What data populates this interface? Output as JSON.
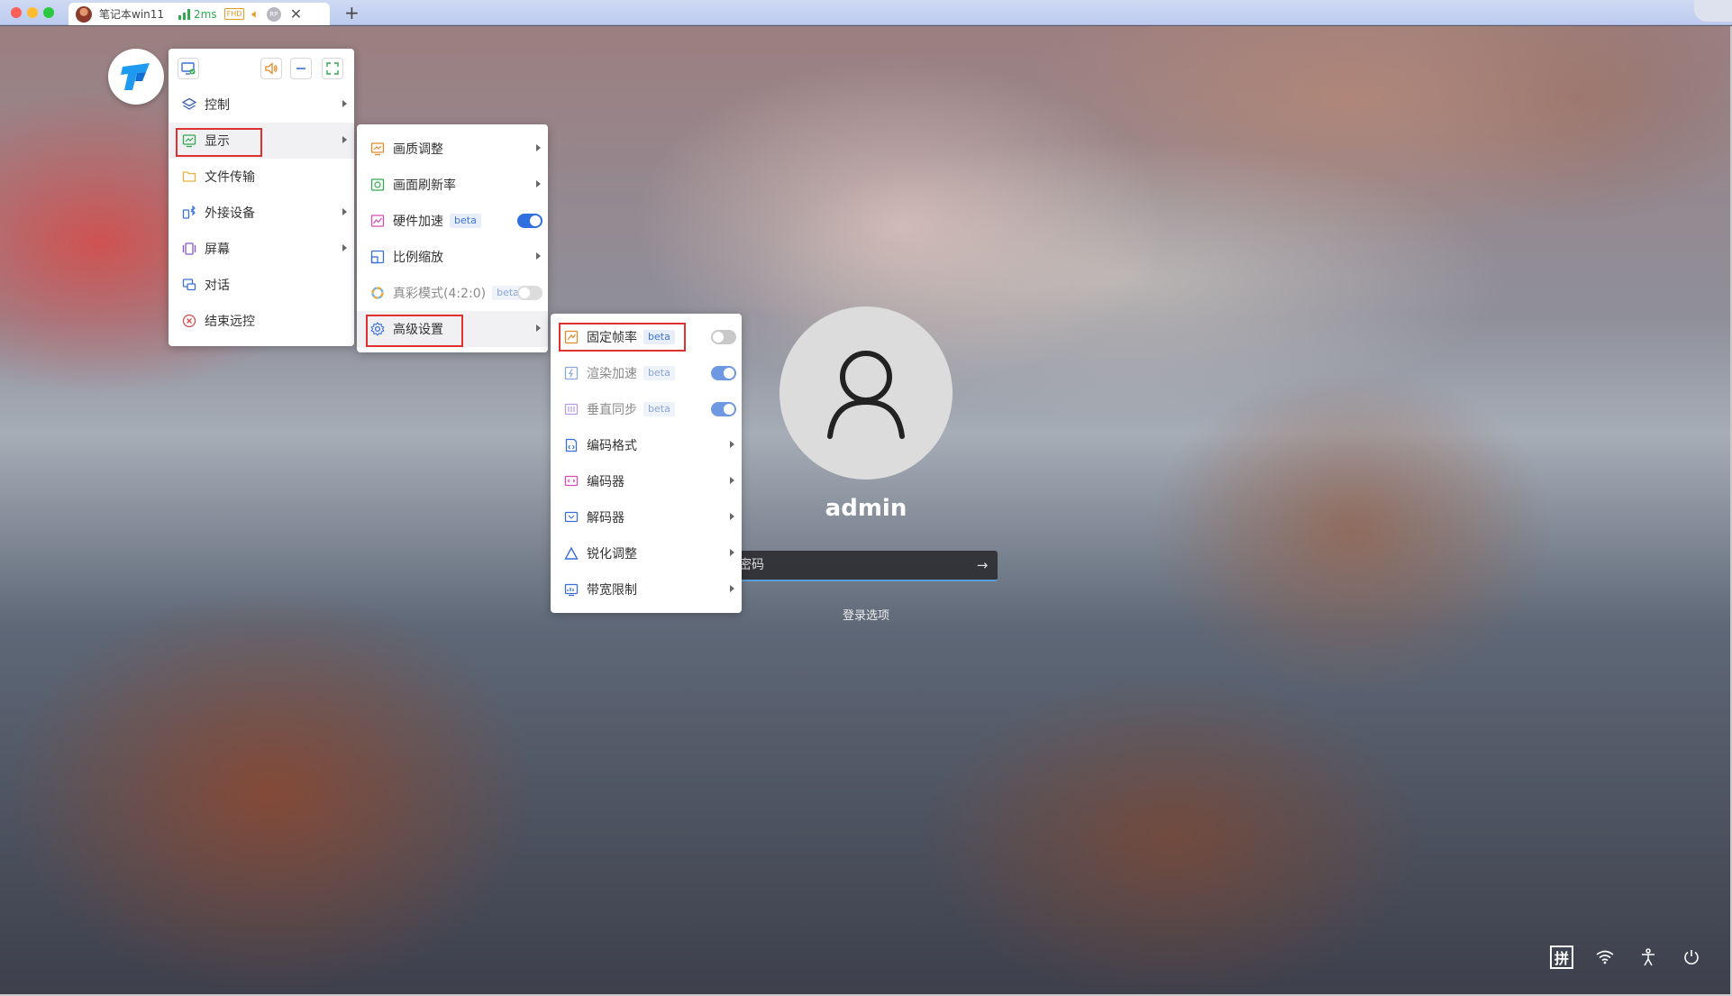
{
  "tab": {
    "title": "笔记本win11",
    "latency": "2ms",
    "fhd_badge": "FHD",
    "rp_badge": "RP",
    "close_glyph": "✕",
    "new_tab_glyph": "+"
  },
  "toolbar": {
    "items": [
      {
        "label": "控制",
        "icon": "layers-icon",
        "color": "#3a5fb8"
      },
      {
        "label": "显示",
        "icon": "monitor-icon",
        "color": "#2fa84f"
      },
      {
        "label": "文件传输",
        "icon": "folder-icon",
        "color": "#e8b23a"
      },
      {
        "label": "外接设备",
        "icon": "bluetooth-device-icon",
        "color": "#3a6fd8"
      },
      {
        "label": "屏幕",
        "icon": "screens-icon",
        "color": "#8855c8"
      },
      {
        "label": "对话",
        "icon": "chat-icon",
        "color": "#3a6fd8"
      },
      {
        "label": "结束远控",
        "icon": "close-circle-icon",
        "color": "#e04848"
      }
    ]
  },
  "display_menu": {
    "items": [
      {
        "label": "画质调整",
        "icon": "image-quality-icon",
        "color": "#e0892a"
      },
      {
        "label": "画面刷新率",
        "icon": "refresh-rate-icon",
        "color": "#2fa84f"
      },
      {
        "label": "硬件加速",
        "badge": "beta",
        "icon": "chart-icon",
        "color": "#d84cb0",
        "toggle": true
      },
      {
        "label": "比例缩放",
        "icon": "scale-icon",
        "color": "#3a6fd8"
      },
      {
        "label": "真彩模式(4:2:0)",
        "badge": "beta",
        "icon": "color-wheel-icon",
        "toggle": false
      },
      {
        "label": "高级设置",
        "icon": "gear-icon",
        "color": "#3a6fd8"
      }
    ]
  },
  "advanced_menu": {
    "items": [
      {
        "label": "固定帧率",
        "badge": "beta",
        "icon": "frame-rate-icon",
        "color": "#e0892a",
        "toggle": false
      },
      {
        "label": "渲染加速",
        "badge": "beta",
        "icon": "render-icon",
        "color": "#3a6fd8",
        "toggle": true
      },
      {
        "label": "垂直同步",
        "badge": "beta",
        "icon": "vsync-icon",
        "color": "#a070e0",
        "toggle": true
      },
      {
        "label": "编码格式",
        "icon": "code-format-icon",
        "color": "#3a6fd8"
      },
      {
        "label": "编码器",
        "icon": "encoder-icon",
        "color": "#d84cb0"
      },
      {
        "label": "解码器",
        "icon": "decoder-icon",
        "color": "#3a6fd8"
      },
      {
        "label": "锐化调整",
        "icon": "triangle-icon",
        "color": "#3a6fd8"
      },
      {
        "label": "带宽限制",
        "icon": "bandwidth-icon",
        "color": "#3a6fd8"
      }
    ]
  },
  "login": {
    "username": "admin",
    "password_placeholder": "密码",
    "options_label": "登录选项"
  },
  "tray": {
    "ime": "拼"
  },
  "colors": {
    "accent": "#2f6fe0",
    "highlight_box": "#e03030",
    "latency_green": "#2fa84f"
  }
}
